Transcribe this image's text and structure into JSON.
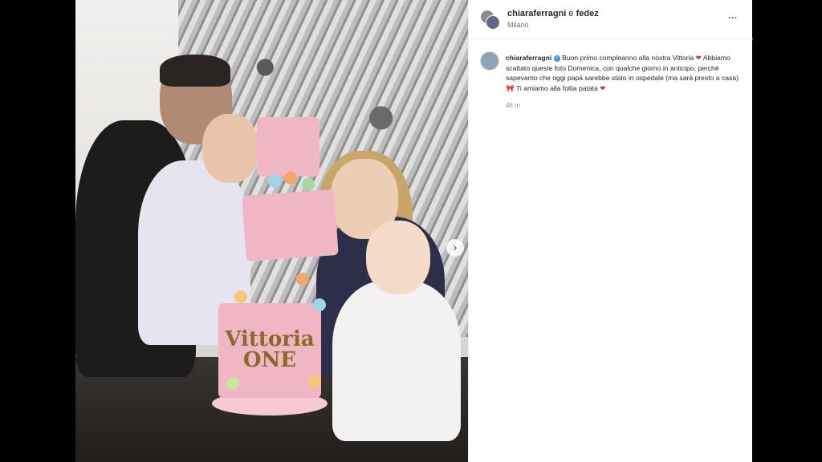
{
  "post": {
    "header": {
      "usernames": "chiaraferragni e fedez",
      "username_primary": "chiaraferragni",
      "username_joiner": " e ",
      "username_secondary": "fedez",
      "location": "Milano",
      "more_icon": "···"
    },
    "photo": {
      "cake_text_line1": "Vittoria",
      "cake_text_line2": "ONE",
      "next_icon": "›"
    },
    "caption": {
      "username": "chiaraferragni",
      "text_part1": "Buon primo compleanno alla nostra Vittoria",
      "text_part2": "Abbiamo scattato queste foto Domenica, con qualche giorno in anticipo, perché sapevamo che oggi papà sarebbe stato in ospedale (ma sarà presto a casa)",
      "text_part3": "Ti amiamo alla follia patata",
      "heart_emoji": "❤",
      "bow_emoji": "🎀",
      "verified_icon": "✓",
      "timestamp": "46 m"
    }
  }
}
